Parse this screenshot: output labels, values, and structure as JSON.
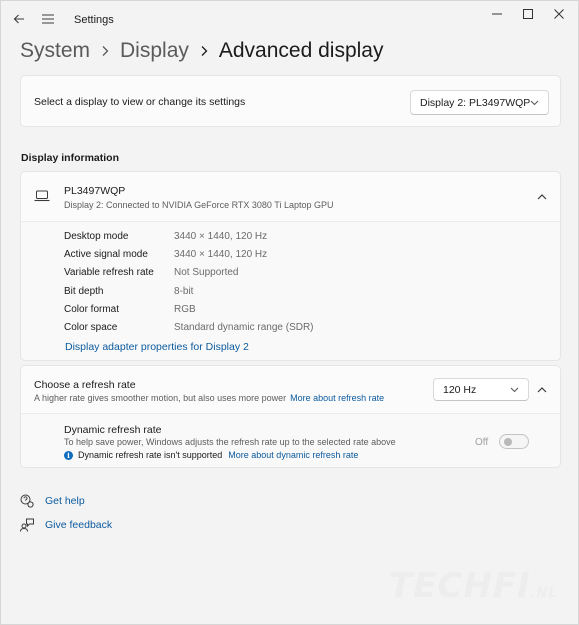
{
  "window": {
    "title": "Settings"
  },
  "breadcrumb": {
    "items": [
      "System",
      "Display"
    ],
    "current": "Advanced display"
  },
  "display_select": {
    "label": "Select a display to view or change its settings",
    "selected": "Display 2: PL3497WQP"
  },
  "display_information": {
    "section_title": "Display information",
    "monitor_name": "PL3497WQP",
    "monitor_subtitle": "Display 2: Connected to NVIDIA GeForce RTX 3080 Ti Laptop GPU",
    "rows": [
      {
        "key": "Desktop mode",
        "value": "3440 × 1440, 120 Hz"
      },
      {
        "key": "Active signal mode",
        "value": "3440 × 1440, 120 Hz"
      },
      {
        "key": "Variable refresh rate",
        "value": "Not Supported"
      },
      {
        "key": "Bit depth",
        "value": "8-bit"
      },
      {
        "key": "Color format",
        "value": "RGB"
      },
      {
        "key": "Color space",
        "value": "Standard dynamic range (SDR)"
      }
    ],
    "adapter_link": "Display adapter properties for Display 2"
  },
  "refresh_rate": {
    "title": "Choose a refresh rate",
    "subtitle": "A higher rate gives smoother motion, but also uses more power",
    "more_link": "More about refresh rate",
    "selected": "120 Hz",
    "dynamic": {
      "title": "Dynamic refresh rate",
      "subtitle": "To help save power, Windows adjusts the refresh rate up to the selected rate above",
      "note": "Dynamic refresh rate isn't supported",
      "note_link": "More about dynamic refresh rate",
      "toggle_label": "Off",
      "toggle_on": false
    }
  },
  "footer": {
    "get_help": "Get help",
    "give_feedback": "Give feedback"
  },
  "watermark": {
    "text": "TECHFI",
    "suffix": ".NL"
  }
}
